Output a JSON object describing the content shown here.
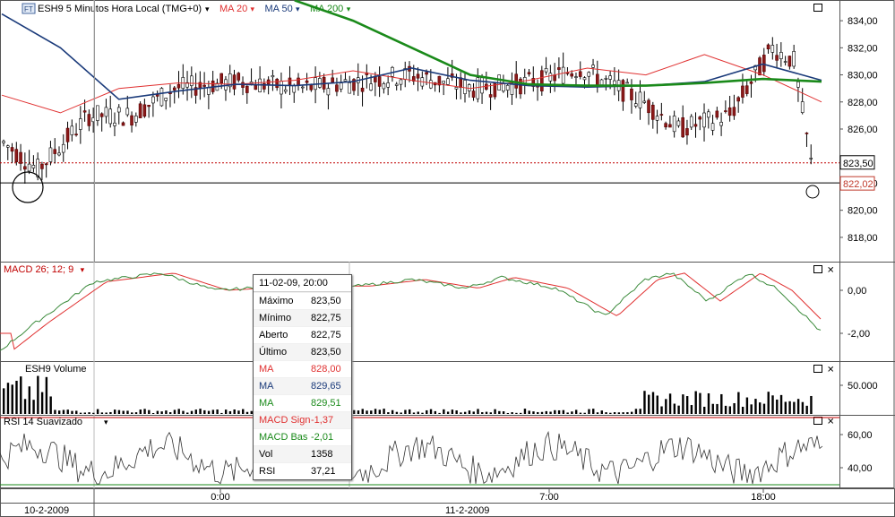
{
  "header": {
    "symbol_icon": "ft-icon",
    "title": "ESH9 5 Minutos Hora Local (TMG+0)",
    "studies": [
      {
        "label": "MA 20",
        "color": "#e03030"
      },
      {
        "label": "MA 50",
        "color": "#1a3a7a"
      },
      {
        "label": "MA 200",
        "color": "#1a8a1a"
      }
    ]
  },
  "price_axis": {
    "ticks": [
      "834,00",
      "832,00",
      "830,00",
      "828,00",
      "826,00",
      "822,00",
      "820,00",
      "818,00"
    ],
    "last_price_tag": "823,50",
    "cursor_price_tag": "822,02"
  },
  "macd_panel": {
    "label": "MACD 26; 12; 9",
    "ticks": [
      "0,00",
      "-2,00"
    ]
  },
  "volume_panel": {
    "label": "ESH9 Volume",
    "ticks": [
      "50.000"
    ]
  },
  "rsi_panel": {
    "label": "RSI 14 Suavizado",
    "ticks": [
      "60,00",
      "40,00"
    ]
  },
  "time_axis": {
    "ticks": [
      "0:00",
      "7:00",
      "18:00"
    ],
    "dates": [
      "10-2-2009",
      "11-2-2009"
    ]
  },
  "tooltip": {
    "header": "11-02-09, 20:00",
    "rows": [
      {
        "key": "Máximo",
        "value": "823,50",
        "color": "#000000"
      },
      {
        "key": "Mínimo",
        "value": "822,75",
        "color": "#000000"
      },
      {
        "key": "Aberto",
        "value": "822,75",
        "color": "#000000"
      },
      {
        "key": "Último",
        "value": "823,50",
        "color": "#000000"
      },
      {
        "key": "MA",
        "value": "828,00",
        "color": "#e03030"
      },
      {
        "key": "MA",
        "value": "829,65",
        "color": "#1a3a7a"
      },
      {
        "key": "MA",
        "value": "829,51",
        "color": "#1a8a1a"
      },
      {
        "key": "MACD Sign",
        "value": "-1,37",
        "color": "#e03030"
      },
      {
        "key": "MACD Bas",
        "value": "-2,01",
        "color": "#1a8a1a"
      },
      {
        "key": "Vol",
        "value": "1358",
        "color": "#000000"
      },
      {
        "key": "RSI",
        "value": "37,21",
        "color": "#000000"
      }
    ]
  },
  "chart_data": {
    "type": "line",
    "title": "ESH9 5 Minutos Hora Local (TMG+0)",
    "x": [
      "10-2-2009",
      "0:00",
      "7:00",
      "18:00"
    ],
    "ylim": [
      817,
      835
    ],
    "series": [
      {
        "name": "MA 20",
        "color": "#e03030",
        "values": [
          828.5,
          827.2,
          829.0,
          829.4,
          829.3,
          829.6,
          830.3,
          829.6,
          829.0,
          829.6,
          830.5,
          830.0,
          831.5,
          830.0,
          828.0
        ]
      },
      {
        "name": "MA 50",
        "color": "#1a3a7a",
        "values": [
          834.5,
          832.0,
          828.2,
          828.8,
          829.3,
          829.2,
          829.5,
          830.5,
          829.6,
          829.2,
          829.1,
          829.2,
          829.5,
          830.8,
          829.6
        ]
      },
      {
        "name": "MA 200",
        "color": "#1a8a1a",
        "values": [
          null,
          null,
          null,
          null,
          null,
          835.5,
          834.0,
          832.0,
          830.0,
          829.3,
          829.2,
          829.2,
          829.4,
          829.7,
          829.5
        ]
      }
    ],
    "last_price": 823.5,
    "cursor_price": 822.02,
    "grid": false
  }
}
